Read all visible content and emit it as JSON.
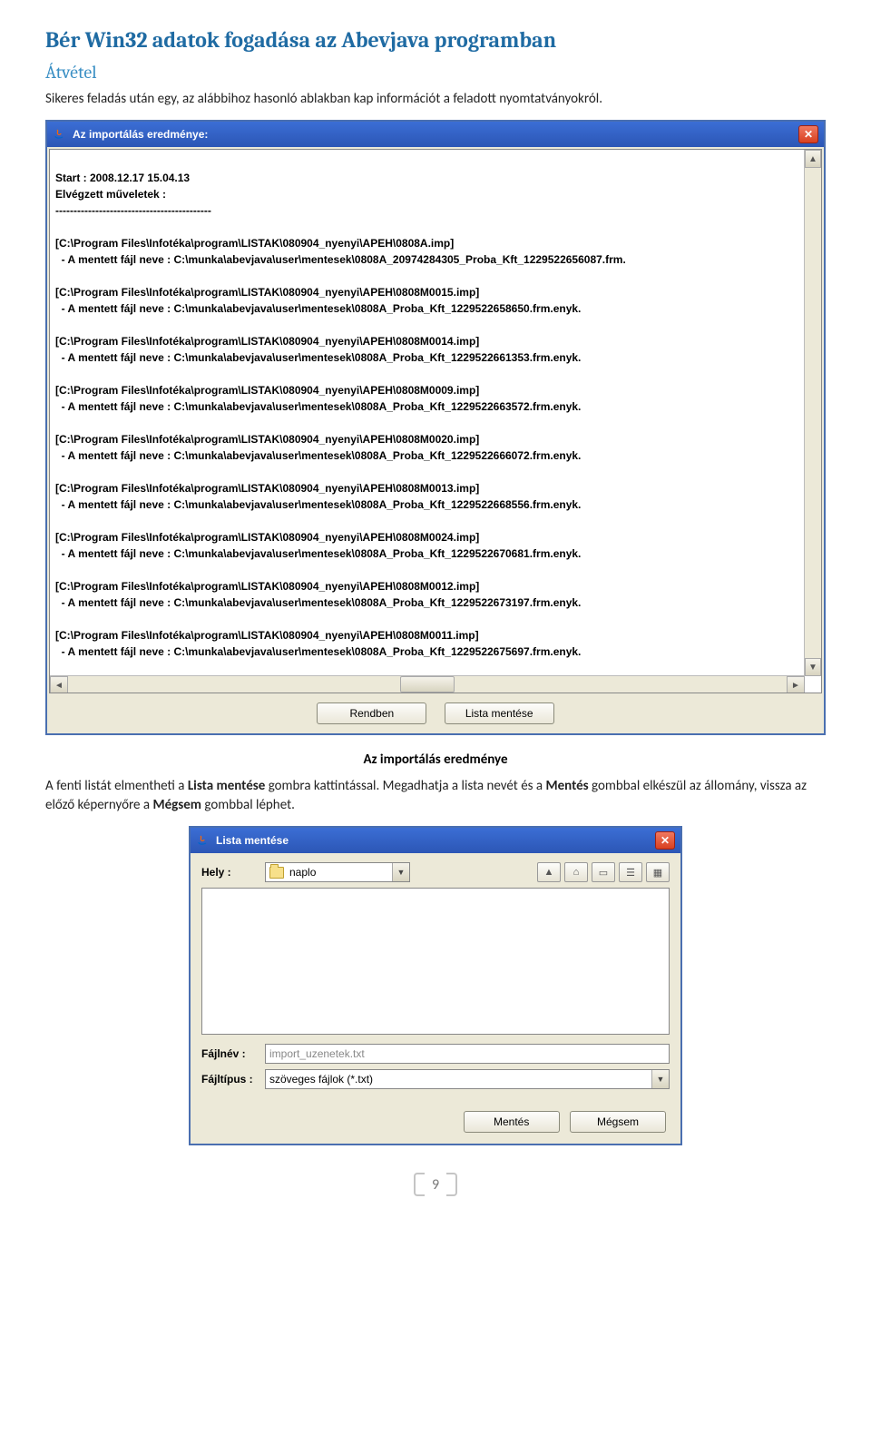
{
  "doc": {
    "title": "Bér Win32 adatok fogadása az Abevjava programban",
    "subtitle": "Átvétel",
    "para1": "Sikeres feladás után egy, az alábbihoz hasonló ablakban kap információt a feladott nyomtatványokról.",
    "caption1": "Az importálás eredménye",
    "para2_a": "A fenti listát elmentheti a ",
    "para2_b": "Lista mentése",
    "para2_c": " gombra kattintással. Megadhatja a lista nevét és a ",
    "para2_d": "Mentés",
    "para2_e": " gombbal elkészül az állomány, vissza az előző képernyőre a ",
    "para2_f": "Mégsem",
    "para2_g": " gombbal léphet.",
    "page_number": "9"
  },
  "import_window": {
    "title": "Az importálás eredménye:",
    "log": "Start : 2008.12.17 15.04.13\nElvégzett műveletek :\n-------------------------------------------\n\n[C:\\Program Files\\Infotéka\\program\\LISTAK\\080904_nyenyi\\APEH\\0808A.imp]\n  - A mentett fájl neve : C:\\munka\\abevjava\\user\\mentesek\\0808A_20974284305_Proba_Kft_1229522656087.frm.\n\n[C:\\Program Files\\Infotéka\\program\\LISTAK\\080904_nyenyi\\APEH\\0808M0015.imp]\n  - A mentett fájl neve : C:\\munka\\abevjava\\user\\mentesek\\0808A_Proba_Kft_1229522658650.frm.enyk.\n\n[C:\\Program Files\\Infotéka\\program\\LISTAK\\080904_nyenyi\\APEH\\0808M0014.imp]\n  - A mentett fájl neve : C:\\munka\\abevjava\\user\\mentesek\\0808A_Proba_Kft_1229522661353.frm.enyk.\n\n[C:\\Program Files\\Infotéka\\program\\LISTAK\\080904_nyenyi\\APEH\\0808M0009.imp]\n  - A mentett fájl neve : C:\\munka\\abevjava\\user\\mentesek\\0808A_Proba_Kft_1229522663572.frm.enyk.\n\n[C:\\Program Files\\Infotéka\\program\\LISTAK\\080904_nyenyi\\APEH\\0808M0020.imp]\n  - A mentett fájl neve : C:\\munka\\abevjava\\user\\mentesek\\0808A_Proba_Kft_1229522666072.frm.enyk.\n\n[C:\\Program Files\\Infotéka\\program\\LISTAK\\080904_nyenyi\\APEH\\0808M0013.imp]\n  - A mentett fájl neve : C:\\munka\\abevjava\\user\\mentesek\\0808A_Proba_Kft_1229522668556.frm.enyk.\n\n[C:\\Program Files\\Infotéka\\program\\LISTAK\\080904_nyenyi\\APEH\\0808M0024.imp]\n  - A mentett fájl neve : C:\\munka\\abevjava\\user\\mentesek\\0808A_Proba_Kft_1229522670681.frm.enyk.\n\n[C:\\Program Files\\Infotéka\\program\\LISTAK\\080904_nyenyi\\APEH\\0808M0012.imp]\n  - A mentett fájl neve : C:\\munka\\abevjava\\user\\mentesek\\0808A_Proba_Kft_1229522673197.frm.enyk.\n\n[C:\\Program Files\\Infotéka\\program\\LISTAK\\080904_nyenyi\\APEH\\0808M0011.imp]\n  - A mentett fájl neve : C:\\munka\\abevjava\\user\\mentesek\\0808A_Proba_Kft_1229522675697.frm.enyk.",
    "btn_ok": "Rendben",
    "btn_save_list": "Lista mentése"
  },
  "save_dialog": {
    "title": "Lista mentése",
    "location_label": "Hely :",
    "location_value": "naplo",
    "filename_label": "Fájlnév :",
    "filename_value": "import_uzenetek.txt",
    "filetype_label": "Fájltípus :",
    "filetype_value": "szöveges fájlok (*.txt)",
    "btn_save": "Mentés",
    "btn_cancel": "Mégsem"
  }
}
